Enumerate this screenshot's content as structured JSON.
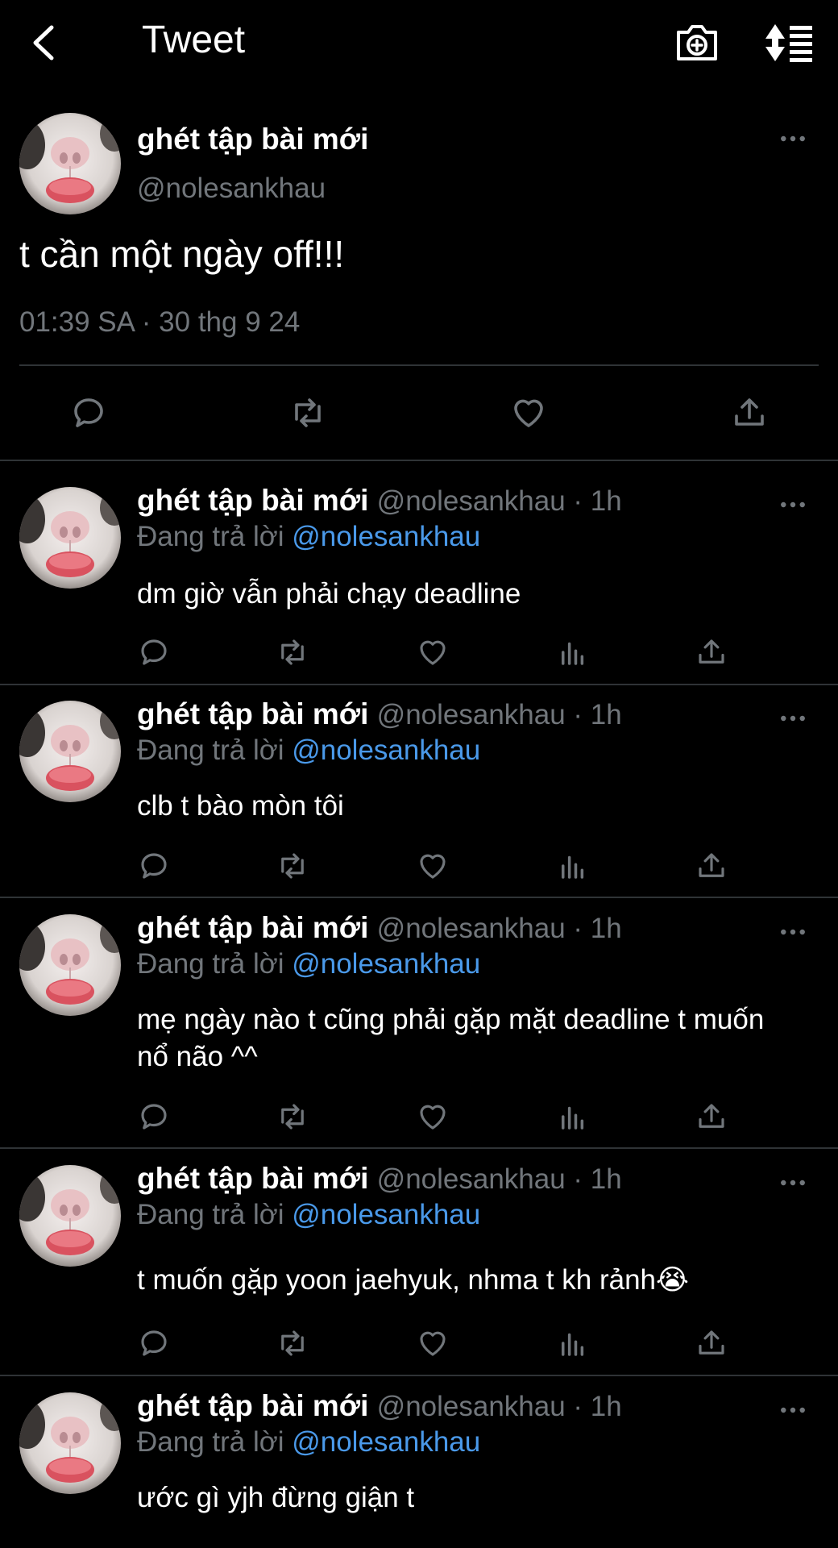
{
  "header": {
    "title": "Tweet",
    "back_icon": "chevron-left-icon",
    "camera_icon": "camera-plus-icon",
    "sort_icon": "sort-icon"
  },
  "main_tweet": {
    "name": "ghét tập bài mới",
    "handle": "@nolesankhau",
    "text": "t cần một ngày off!!!",
    "timestamp": "01:39 SA · 30 thg 9 24"
  },
  "colors": {
    "background": "#000000",
    "link": "#4a99e9",
    "secondary": "#71767b",
    "divider": "#2f3336"
  },
  "replies": [
    {
      "name": "ghét tập bài mới",
      "meta": "@nolesankhau · 1h",
      "replying_prefix": "Đang trả lời",
      "replying_to": "@nolesankhau",
      "text": "dm giờ vẫn phải chạy deadline"
    },
    {
      "name": "ghét tập bài mới",
      "meta": "@nolesankhau · 1h",
      "replying_prefix": "Đang trả lời",
      "replying_to": "@nolesankhau",
      "text": "clb t bào mòn tôi"
    },
    {
      "name": "ghét tập bài mới",
      "meta": "@nolesankhau · 1h",
      "replying_prefix": "Đang trả lời",
      "replying_to": "@nolesankhau",
      "text": "mẹ ngày nào t cũng phải gặp mặt deadline t muốn nổ não ^^"
    },
    {
      "name": "ghét tập bài mới",
      "meta": "@nolesankhau · 1h",
      "replying_prefix": "Đang trả lời",
      "replying_to": "@nolesankhau",
      "text": "t muốn gặp yoon jaehyuk, nhma t kh rảnh😭"
    },
    {
      "name": "ghét tập bài mới",
      "meta": "@nolesankhau · 1h",
      "replying_prefix": "Đang trả lời",
      "replying_to": "@nolesankhau",
      "text": "ước gì yjh đừng giận t"
    }
  ]
}
